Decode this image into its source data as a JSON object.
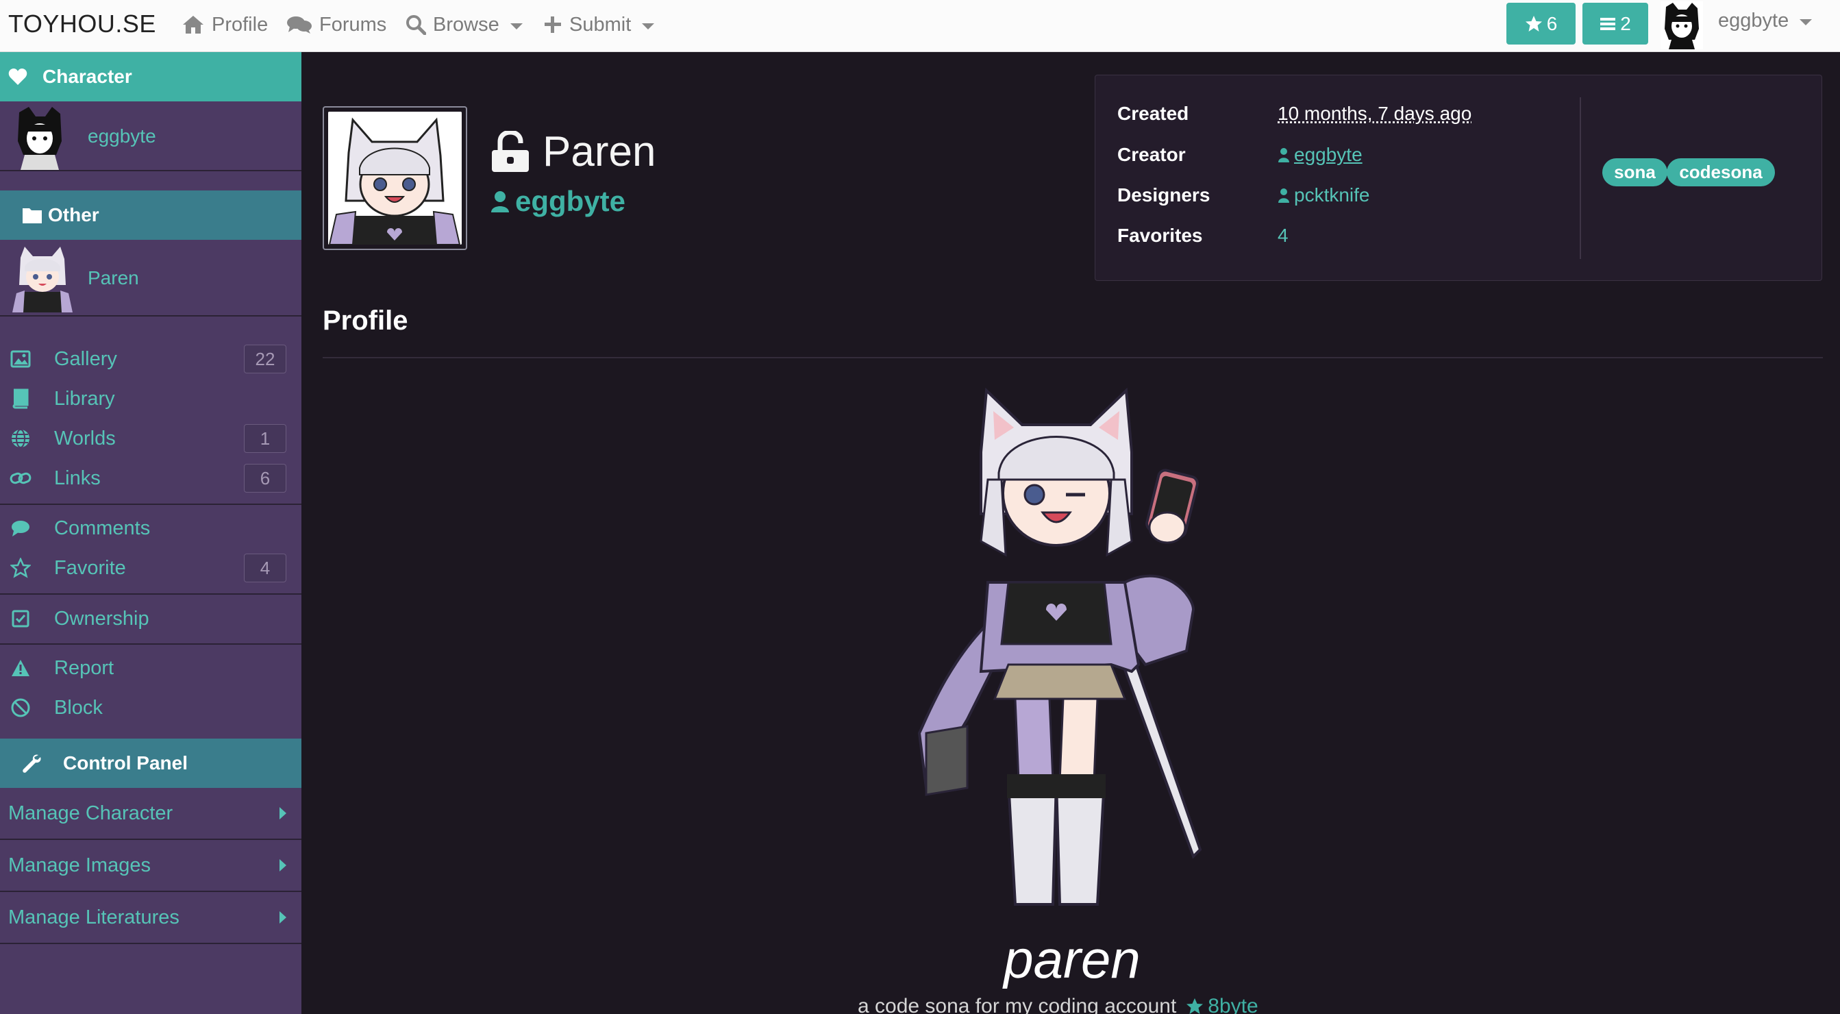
{
  "topbar": {
    "brand": "TOYHOU.SE",
    "nav": [
      {
        "label": "Profile",
        "icon": "home-icon"
      },
      {
        "label": "Forums",
        "icon": "comments-icon"
      },
      {
        "label": "Browse",
        "icon": "search-icon"
      },
      {
        "label": "Submit",
        "icon": "plus-icon"
      }
    ],
    "favorites_count": "6",
    "list_count": "2",
    "username": "eggbyte"
  },
  "sidebar": {
    "character_header": "Character",
    "user": "eggbyte",
    "folder_header": "Other",
    "character": "Paren",
    "items": [
      {
        "label": "Gallery",
        "count": "22",
        "icon": "image-icon"
      },
      {
        "label": "Library",
        "count": "",
        "icon": "book-icon"
      },
      {
        "label": "Worlds",
        "count": "1",
        "icon": "globe-icon"
      },
      {
        "label": "Links",
        "count": "6",
        "icon": "link-icon"
      },
      {
        "label": "Comments",
        "count": "",
        "icon": "comment-icon"
      },
      {
        "label": "Favorite",
        "count": "4",
        "icon": "star-icon"
      },
      {
        "label": "Ownership",
        "count": "",
        "icon": "check-square-icon"
      },
      {
        "label": "Report",
        "count": "",
        "icon": "warning-icon"
      },
      {
        "label": "Block",
        "count": "",
        "icon": "ban-icon"
      }
    ],
    "control_panel_header": "Control Panel",
    "manage_links": [
      "Manage Character",
      "Manage Images",
      "Manage Literatures"
    ]
  },
  "character": {
    "name": "Paren",
    "owner": "eggbyte",
    "info": {
      "created_label": "Created",
      "created_value": "10 months, 7 days ago",
      "creator_label": "Creator",
      "creator_value": "eggbyte",
      "designers_label": "Designers",
      "designers_value": "pcktknife",
      "favorites_label": "Favorites",
      "favorites_value": "4"
    },
    "tags": [
      "sona",
      "codesona"
    ]
  },
  "profile": {
    "heading": "Profile",
    "display_name": "paren",
    "tagline": "a code sona for my coding account",
    "tagline_link": "8byte"
  },
  "colors": {
    "accent": "#3fb1a4",
    "sidebar_bg": "#4c3a63",
    "header_bg": "#3a7d8c",
    "page_bg": "#1c1720"
  }
}
